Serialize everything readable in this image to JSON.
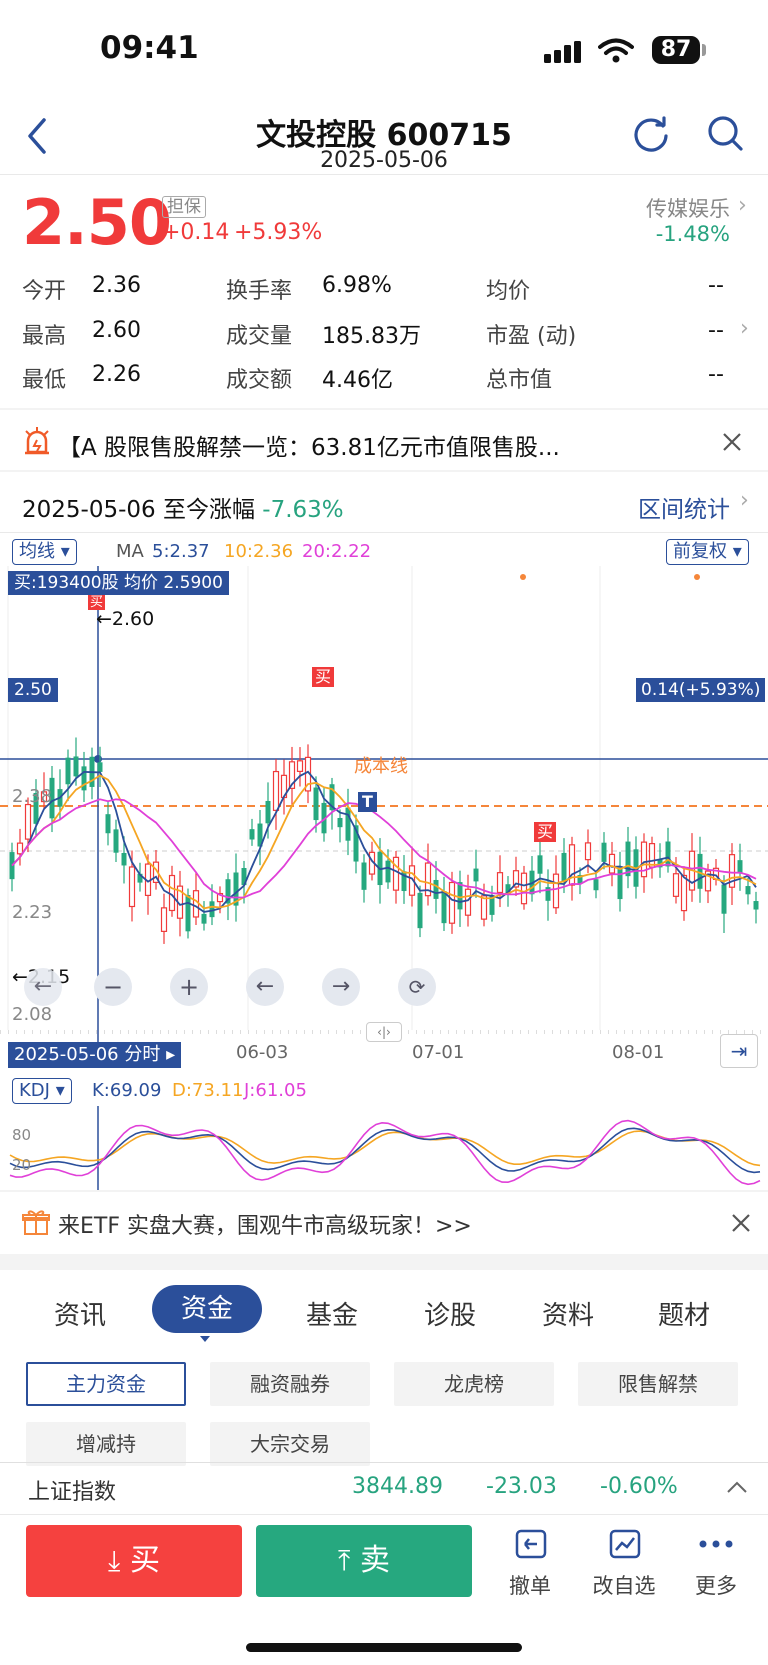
{
  "status_bar": {
    "time": "09:41",
    "battery": "87"
  },
  "header": {
    "title": "文投控股 600715",
    "date": "2025-05-06"
  },
  "quote": {
    "price": "2.50",
    "badge": "担保",
    "change_abs": "+0.14",
    "change_pct": "+5.93%",
    "sector_name": "传媒娱乐",
    "sector_change": "-1.48%",
    "stats": [
      {
        "label": "今开",
        "value": "2.36"
      },
      {
        "label": "换手率",
        "value": "6.98%"
      },
      {
        "label": "均价",
        "value": "--"
      },
      {
        "label": "最高",
        "value": "2.60"
      },
      {
        "label": "成交量",
        "value": "185.83万"
      },
      {
        "label": "市盈 (动)",
        "value": "--"
      },
      {
        "label": "最低",
        "value": "2.26"
      },
      {
        "label": "成交额",
        "value": "4.46亿"
      },
      {
        "label": "总市值",
        "value": "--"
      }
    ]
  },
  "notice": {
    "text": "【A 股限售股解禁一览：63.81亿元市值限售股..."
  },
  "period": {
    "label": "2025-05-06 至今涨幅",
    "change": "-7.63%",
    "stats_link": "区间统计"
  },
  "chart": {
    "ma_selector": "均线",
    "ma_title": "MA",
    "ma5": "5:2.37",
    "ma10": "10:2.36",
    "ma20": "20:2.22",
    "adjust_selector": "前复权",
    "buy_info": "买:193400股 均价 2.5900",
    "price_tag_left": "2.50",
    "price_tag_right": "0.14(+5.93%)",
    "high_marker": "←2.60",
    "low_marker": "←2.15",
    "cost_line_label": "成本线",
    "y_labels": [
      "2.38",
      "2.23",
      "2.08"
    ],
    "x_labels": [
      "06-03",
      "07-01",
      "08-01"
    ],
    "date_badge": "2025-05-06 分时",
    "buy_tag": "买",
    "t_tag": "T",
    "colors": {
      "up": "#f03a3a",
      "down": "#26a87f",
      "ma5": "#2b4f9a",
      "ma10": "#f5a623",
      "ma20": "#e040d8",
      "cost": "#f5863a"
    }
  },
  "kdj": {
    "selector": "KDJ",
    "k": "K:69.09",
    "d": "D:73.11",
    "j": "J:61.05",
    "y_labels": [
      "80",
      "20"
    ]
  },
  "promo": {
    "text": "来ETF 实盘大赛，围观牛市高级玩家！>>"
  },
  "tabs": [
    "资讯",
    "资金",
    "基金",
    "诊股",
    "资料",
    "题材"
  ],
  "active_tab": "资金",
  "subtabs": [
    "主力资金",
    "融资融券",
    "龙虎榜",
    "限售解禁",
    "增减持",
    "大宗交易"
  ],
  "index_bar": {
    "name": "上证指数",
    "value": "3844.89",
    "change": "-23.03",
    "pct": "-0.60%"
  },
  "actions": {
    "buy": "买",
    "sell": "卖",
    "cancel": "撤单",
    "edit_watch": "改自选",
    "more": "更多"
  }
}
